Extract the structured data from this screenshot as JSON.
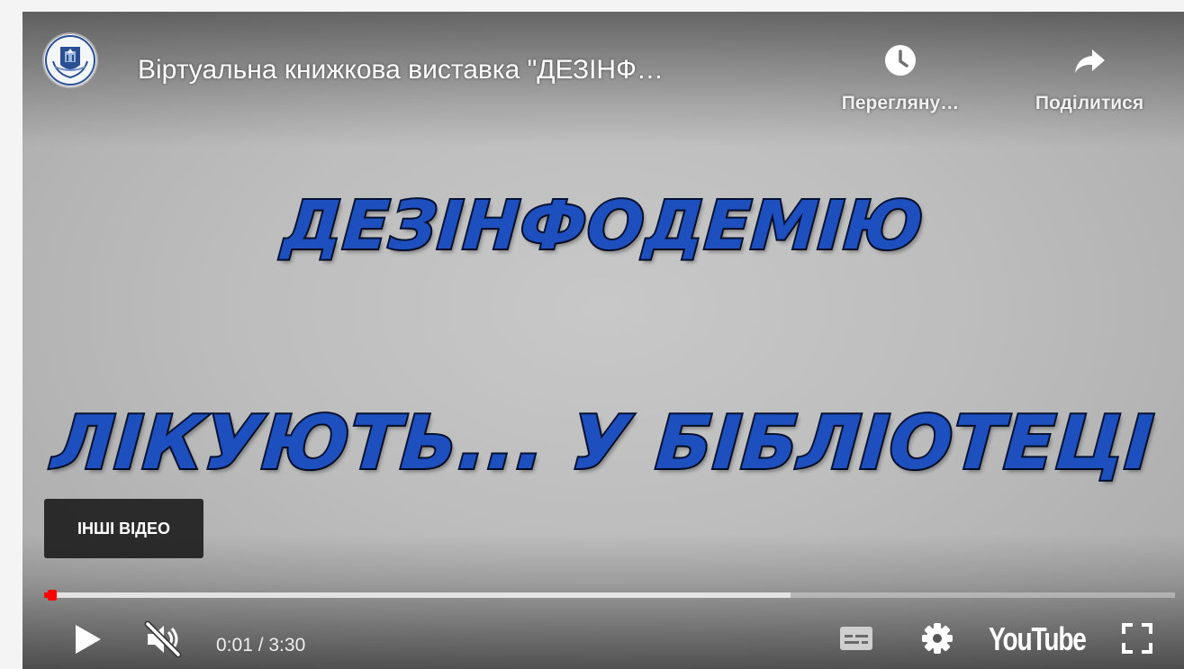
{
  "player": {
    "title": "Віртуальна книжкова виставка \"ДЕЗІНФ…",
    "channel_logo_icon": "library-emblem-icon",
    "top_actions": [
      {
        "label": "Перегляну…",
        "icon": "clock-icon"
      },
      {
        "label": "Поділитися",
        "icon": "share-arrow-icon"
      }
    ],
    "slide": {
      "line1": "ДЕЗІНФОДЕМІЮ",
      "line2": "ЛІКУЮТЬ... У БІБЛІОТЕЦІ"
    },
    "more_videos_label": "ІНШІ ВІДЕО",
    "progress": {
      "played_fraction": 0.005,
      "buffered_fraction": 0.66
    },
    "controls": {
      "time": "0:01 / 3:30",
      "play_icon": "play-icon",
      "mute_icon": "volume-muted-icon",
      "subtitles_icon": "subtitles-icon",
      "settings_icon": "gear-icon",
      "brand": "YouTube",
      "fullscreen_icon": "fullscreen-icon"
    },
    "colors": {
      "progress_played": "#ff0000",
      "slide_text": "#1d4fbf",
      "slide_outline": "#041233"
    }
  }
}
